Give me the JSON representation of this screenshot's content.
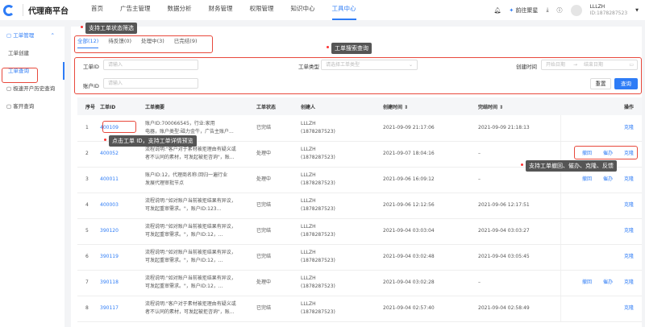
{
  "header": {
    "brand": "代理商平台",
    "nav": [
      "首页",
      "广告主管理",
      "数据分析",
      "财务管理",
      "权限管理",
      "知识中心",
      "工具中心"
    ],
    "active_nav": 6,
    "goto": "前往聚星",
    "user_name": "LLLZH",
    "user_id": "ID:1878287523"
  },
  "sidebar": {
    "group": "工单管理",
    "items": [
      "工单创建",
      "工单查询"
    ],
    "others": [
      "极速开户历史查询",
      "客开查询"
    ]
  },
  "tabs": [
    "全部(12)",
    "待反馈(0)",
    "处理中(3)",
    "已完结(9)"
  ],
  "search": {
    "id_label": "工单ID",
    "id_placeholder": "请输入",
    "type_label": "工单类型",
    "type_placeholder": "请选择工单类型",
    "time_label": "创建时间",
    "start": "开始日期",
    "end": "结束日期",
    "account_label": "账户ID",
    "account_placeholder": "请输入",
    "reset": "重置",
    "query": "查询"
  },
  "table": {
    "headers": [
      "序号",
      "工单ID",
      "工单摘要",
      "工单状态",
      "创建人",
      "创建时间 ⇕",
      "完结时间 ⇕",
      "操作"
    ],
    "rows": [
      {
        "no": "1",
        "id": "400109",
        "s1": "账户ID:700066545，行业:家用",
        "s2": "电器，账户类型:磁力金牛，广告主账户...",
        "status": "已完结",
        "c1": "LLLZH",
        "c2": "(1878287523)",
        "created": "2021-09-09 21:17:06",
        "done": "2021-09-09 21:18:13",
        "ops": [
          "克隆"
        ]
      },
      {
        "no": "2",
        "id": "400052",
        "s1": "流程说明:\"客户对于素材被拒理由有疑义或",
        "s2": "者不认同的素材，可发起被拒咨询\"，账...",
        "status": "处理中",
        "c1": "LLLZH",
        "c2": "(1878287523)",
        "created": "2021-09-07 18:04:16",
        "done": "–",
        "ops": [
          "撤回",
          "催办",
          "克隆"
        ]
      },
      {
        "no": "3",
        "id": "400011",
        "s1": "账户ID:12，代理商名称:回归一遍行业",
        "s2": "发展代理审批节点",
        "status": "处理中",
        "c1": "LLLZH",
        "c2": "(1878287523)",
        "created": "2021-09-06 16:09:12",
        "done": "–",
        "ops": [
          "撤回",
          "催办",
          "克隆"
        ]
      },
      {
        "no": "4",
        "id": "400003",
        "s1": "流程说明:\"如对账户当前被拒结果有异议，",
        "s2": "可发起重审需求。\"，账户ID:123...",
        "status": "已完结",
        "c1": "LLLZH",
        "c2": "(1878287523)",
        "created": "2021-09-06 12:12:56",
        "done": "2021-09-06 12:17:51",
        "ops": [
          "克隆"
        ]
      },
      {
        "no": "5",
        "id": "390120",
        "s1": "流程说明:\"如对账户当前被拒结果有异议，",
        "s2": "可发起重审需求。\"，账户ID:12，...",
        "status": "已完结",
        "c1": "LLLZH",
        "c2": "(1878287523)",
        "created": "2021-09-04 03:03:04",
        "done": "2021-09-04 03:03:27",
        "ops": [
          "克隆"
        ]
      },
      {
        "no": "6",
        "id": "390119",
        "s1": "流程说明:\"如对账户当前被拒结果有异议，",
        "s2": "可发起重审需求。\"，账户ID:12，...",
        "status": "已完结",
        "c1": "LLLZH",
        "c2": "(1878287523)",
        "created": "2021-09-04 03:02:48",
        "done": "2021-09-04 03:05:45",
        "ops": [
          "克隆"
        ]
      },
      {
        "no": "7",
        "id": "390118",
        "s1": "流程说明:\"如对账户当前被拒结果有异议，",
        "s2": "可发起重审需求。\"，账户ID:12，...",
        "status": "处理中",
        "c1": "LLLZH",
        "c2": "(1878287523)",
        "created": "2021-09-04 03:02:28",
        "done": "–",
        "ops": [
          "撤回",
          "催办",
          "克隆"
        ]
      },
      {
        "no": "8",
        "id": "390117",
        "s1": "流程说明:\"客户对于素材被拒理由有疑义或",
        "s2": "者不认同的素材，可发起被拒咨询\"，账...",
        "status": "已完结",
        "c1": "LLLZH",
        "c2": "(1878287523)",
        "created": "2021-09-04 02:57:40",
        "done": "2021-09-04 02:58:49",
        "ops": [
          "克隆"
        ]
      }
    ]
  },
  "annotations": [
    "支持工单状态筛选",
    "工单搜索查询",
    "点击工单 ID，支持工单详情预览",
    "支持工单撤回、催办、克隆、反馈"
  ],
  "colors": {
    "accent": "#2e7cf6",
    "highlight": "#e8493c"
  }
}
